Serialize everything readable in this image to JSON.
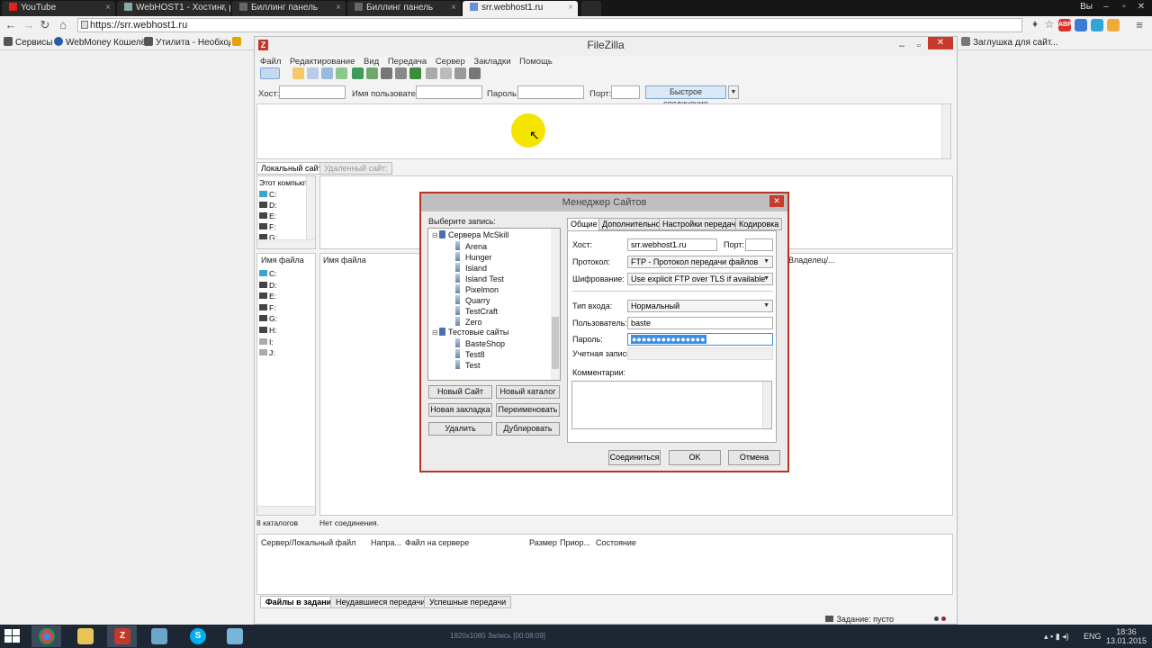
{
  "browser": {
    "tabs": [
      {
        "label": "YouTube",
        "active": false
      },
      {
        "label": "WebHOST1 - Хостинг, ре",
        "active": false
      },
      {
        "label": "Биллинг панель",
        "active": false
      },
      {
        "label": "Биллинг панель",
        "active": false
      },
      {
        "label": "srr.webhost1.ru",
        "active": true
      }
    ],
    "user_label": "Вы",
    "url": "https://srr.webhost1.ru",
    "extension_badge": "ABP",
    "bookmarks": [
      {
        "label": "Сервисы"
      },
      {
        "label": "WebMoney Кошелё..."
      },
      {
        "label": "Утилита - Необход..."
      },
      {
        "label": "Заглушка для сайт..."
      }
    ]
  },
  "filezilla": {
    "title": "FileZilla",
    "menu": [
      "Файл",
      "Редактирование",
      "Вид",
      "Передача",
      "Сервер",
      "Закладки",
      "Помощь"
    ],
    "quickconnect": {
      "host_label": "Хост:",
      "user_label": "Имя пользователя",
      "pass_label": "Пароль:",
      "port_label": "Порт:",
      "button": "Быстрое соединение"
    },
    "local": {
      "tab": "Локальный сайт",
      "tree_root": "Этот компьют",
      "drives": [
        "C:",
        "D:",
        "E:",
        "F:",
        "G:"
      ],
      "col_name": "Имя файла",
      "files": [
        "C:",
        "D:",
        "E:",
        "F:",
        "G:",
        "H:",
        "I:",
        "J:"
      ],
      "status": "8 каталогов"
    },
    "remote": {
      "tab": "Удаленный сайт:",
      "col_name": "Имя файла",
      "col_owner": "Владелец/...",
      "status": "Нет соединения."
    },
    "queue": {
      "cols": [
        "Сервер/Локальный файл",
        "Напра...",
        "Файл на сервере",
        "Размер",
        "Приор...",
        "Состояние"
      ],
      "tabs": [
        "Файлы в задании",
        "Неудавшиеся передачи",
        "Успешные передачи"
      ],
      "status": "Задание: пусто"
    }
  },
  "site_manager": {
    "title": "Менеджер Сайтов",
    "choose_label": "Выберите запись:",
    "tree": [
      {
        "label": "Сервера McSkill",
        "level": 0,
        "folder": true
      },
      {
        "label": "Arena",
        "level": 1
      },
      {
        "label": "Hunger",
        "level": 1
      },
      {
        "label": "Island",
        "level": 1
      },
      {
        "label": "Island Test",
        "level": 1
      },
      {
        "label": "Pixelmon",
        "level": 1
      },
      {
        "label": "Quarry",
        "level": 1
      },
      {
        "label": "TestCraft",
        "level": 1
      },
      {
        "label": "Zero",
        "level": 1
      },
      {
        "label": "Тестовые сайты",
        "level": 0,
        "folder": true
      },
      {
        "label": "BasteShop",
        "level": 1
      },
      {
        "label": "Test8",
        "level": 1
      },
      {
        "label": "Test",
        "level": 1
      }
    ],
    "buttons": {
      "new_site": "Новый Сайт",
      "new_folder": "Новый каталог",
      "new_bookmark": "Новая закладка",
      "rename": "Переименовать",
      "delete": "Удалить",
      "duplicate": "Дублировать"
    },
    "tabs": [
      "Общие",
      "Дополнительно",
      "Настройки передачи",
      "Кодировка"
    ],
    "form": {
      "host_label": "Хост:",
      "host_value": "srr.webhost1.ru",
      "port_label": "Порт:",
      "port_value": "",
      "protocol_label": "Протокол:",
      "protocol_value": "FTP - Протокол передачи файлов",
      "encryption_label": "Шифрование:",
      "encryption_value": "Use explicit FTP over TLS if available",
      "logon_label": "Тип входа:",
      "logon_value": "Нормальный",
      "user_label": "Пользователь:",
      "user_value": "baste",
      "pass_label": "Пароль:",
      "pass_value": "●●●●●●●●●●●●●●●",
      "account_label": "Учетная запись:",
      "comment_label": "Комментарии:"
    },
    "footer": {
      "connect": "Соединиться",
      "ok": "OK",
      "cancel": "Отмена"
    }
  },
  "taskbar": {
    "lang": "ENG",
    "time": "18:36",
    "date": "13.01.2015",
    "rec_info": "1920x1080      Запись [00:08:09]"
  },
  "colors": {
    "accent_red": "#c73a2c",
    "selection_blue": "#3a8ee6",
    "cursor_highlight": "#f5e400"
  }
}
